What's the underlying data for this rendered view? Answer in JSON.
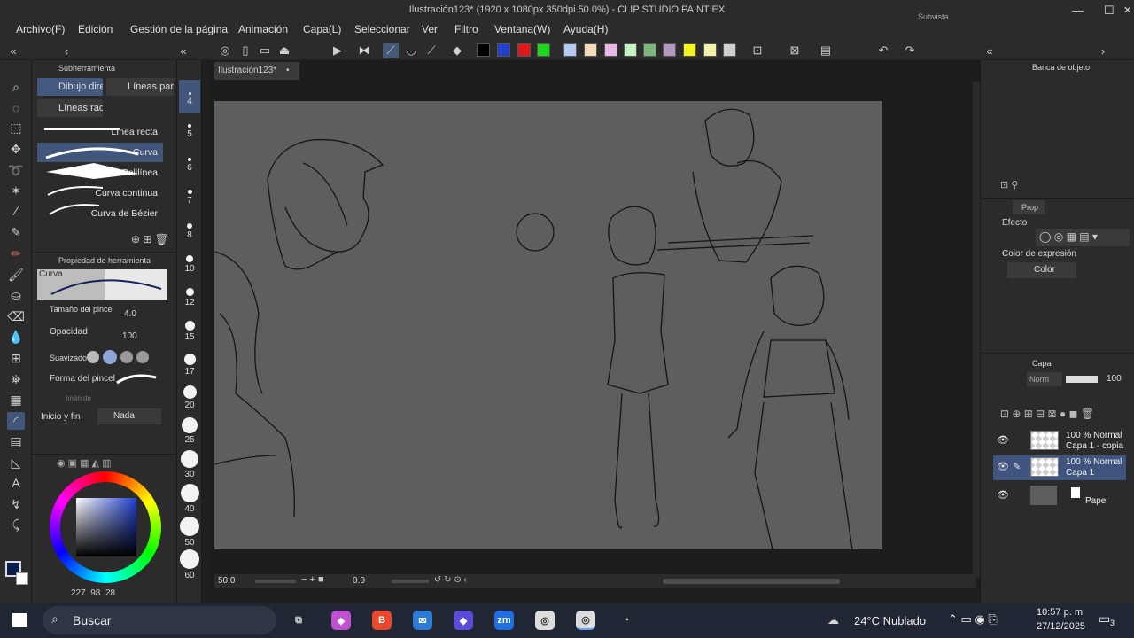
{
  "window": {
    "title": "Ilustración123* (1920 x 1080px 350dpi 50.0%) - CLIP STUDIO PAINT EX",
    "subview": "Subvista",
    "min": "—",
    "max": "☐",
    "close": "✕"
  },
  "menu": [
    "Archivo(F)",
    "Edición",
    "Gestión de la página",
    "Animación",
    "Capa(L)",
    "Seleccionar",
    "Ver",
    "Filtro",
    "Ventana(W)",
    "Ayuda(H)"
  ],
  "colors": {
    "swatches": [
      "#000000",
      "#1f3fcc",
      "#e01818",
      "#1ed81e",
      "#b6c8f4",
      "#f4dcbc",
      "#ecb8e8",
      "#c4f4c4",
      "#7cb87c",
      "#b498c0",
      "#f4f420",
      "#f4f0a8",
      "#cfcfcf"
    ],
    "canvas": "#5e5e5e",
    "accent": "#42557a",
    "line": "#1c1c1c"
  },
  "subtool": {
    "header": "Subherramienta",
    "tab1": "Dibujo dire",
    "tab2": "Líneas par",
    "tab3": "Líneas radi",
    "brushes": [
      "Línea recta",
      "Curva",
      "Polilínea",
      "Curva continua",
      "Curva de Bézier"
    ],
    "selected_brush": "Curva"
  },
  "tool_property": {
    "header": "Propiedad de herramienta",
    "preview_label": "Curva",
    "brush_size_label": "Tamaño del pincel",
    "brush_size": "4.0",
    "opacity_label": "Opacidad",
    "opacity": "100",
    "smoothing_label": "Suavizado",
    "brush_shape_label": "Forma del pincel",
    "magnet_label": "Imán de",
    "start_end_label": "Inicio y fin",
    "start_end_value": "Nada"
  },
  "brush_sizes": [
    "4",
    "5",
    "6",
    "7",
    "8",
    "10",
    "12",
    "15",
    "17",
    "20",
    "25",
    "30",
    "40",
    "50",
    "60"
  ],
  "color_wheel": {
    "r": "227",
    "g": "98",
    "b": "28"
  },
  "document": {
    "tab": "Ilustración123*"
  },
  "canvas_status": {
    "zoom": "50.0",
    "angle": "0.0"
  },
  "right": {
    "object_bank": "Banca de objeto",
    "props_tab": "Prop",
    "effect_label": "Efecto",
    "expression_label": "Color de expresión",
    "expression_value": "Color",
    "layer_tab": "Capa",
    "blend_mode": "Norm",
    "layer_opacity": "100",
    "layers": [
      {
        "mode": "100 % Normal",
        "name": "Capa 1 - copia"
      },
      {
        "mode": "100 % Normal",
        "name": "Capa 1"
      },
      {
        "mode": "",
        "name": "Papel"
      }
    ]
  },
  "taskbar": {
    "search": "Buscar",
    "weather": "24°C  Nublado",
    "time": "10:57 p. m.",
    "date": "27/12/2025",
    "notifications": "3"
  }
}
